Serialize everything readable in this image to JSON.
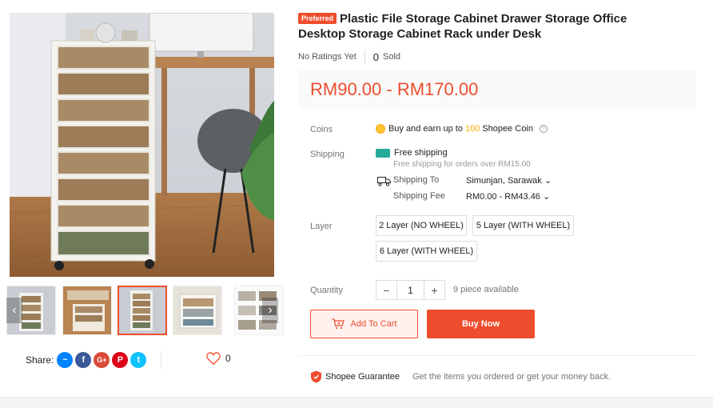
{
  "product": {
    "badge": "Preferred",
    "title": "Plastic File Storage Cabinet Drawer Storage Office Desktop Storage Cabinet Rack under Desk",
    "ratings_text": "No Ratings Yet",
    "sold_count": "0",
    "sold_label": "Sold",
    "price": "RM90.00 - RM170.00"
  },
  "coins": {
    "label": "Coins",
    "prefix": "Buy and earn up to",
    "amount": "100",
    "suffix": "Shopee Coin"
  },
  "shipping": {
    "label": "Shipping",
    "free_title": "Free shipping",
    "free_note": "Free shipping for orders over RM15.00",
    "to_label": "Shipping To",
    "to_value": "Simunjan, Sarawak",
    "fee_label": "Shipping Fee",
    "fee_value": "RM0.00 - RM43.46"
  },
  "layer": {
    "label": "Layer",
    "options": [
      "2 Layer (NO WHEEL)",
      "5 Layer (WITH WHEEL)",
      "6 Layer (WITH WHEEL)"
    ]
  },
  "quantity": {
    "label": "Quantity",
    "minus": "−",
    "value": "1",
    "plus": "+",
    "available": "9 piece available"
  },
  "actions": {
    "add_to_cart": "Add To Cart",
    "buy_now": "Buy Now"
  },
  "guarantee": {
    "title": "Shopee Guarantee",
    "text": "Get the items you ordered or get your money back."
  },
  "share": {
    "label": "Share:",
    "like_count": "0"
  },
  "icons": [
    "coin-icon",
    "help-icon",
    "free-shipping-icon",
    "truck-icon",
    "chevron-down-icon",
    "cart-icon",
    "shield-icon",
    "heart-icon",
    "messenger-icon",
    "facebook-icon",
    "google-plus-icon",
    "pinterest-icon",
    "twitter-icon",
    "chevron-left-icon",
    "chevron-right-icon"
  ],
  "colors": {
    "accent": "#ee4d2d",
    "coin": "#f6a700",
    "free_ship": "#26aa99",
    "messenger": "#0084ff",
    "facebook": "#3b5999",
    "google_plus": "#db4a39",
    "pinterest": "#de0217",
    "twitter": "#10c2ff"
  }
}
